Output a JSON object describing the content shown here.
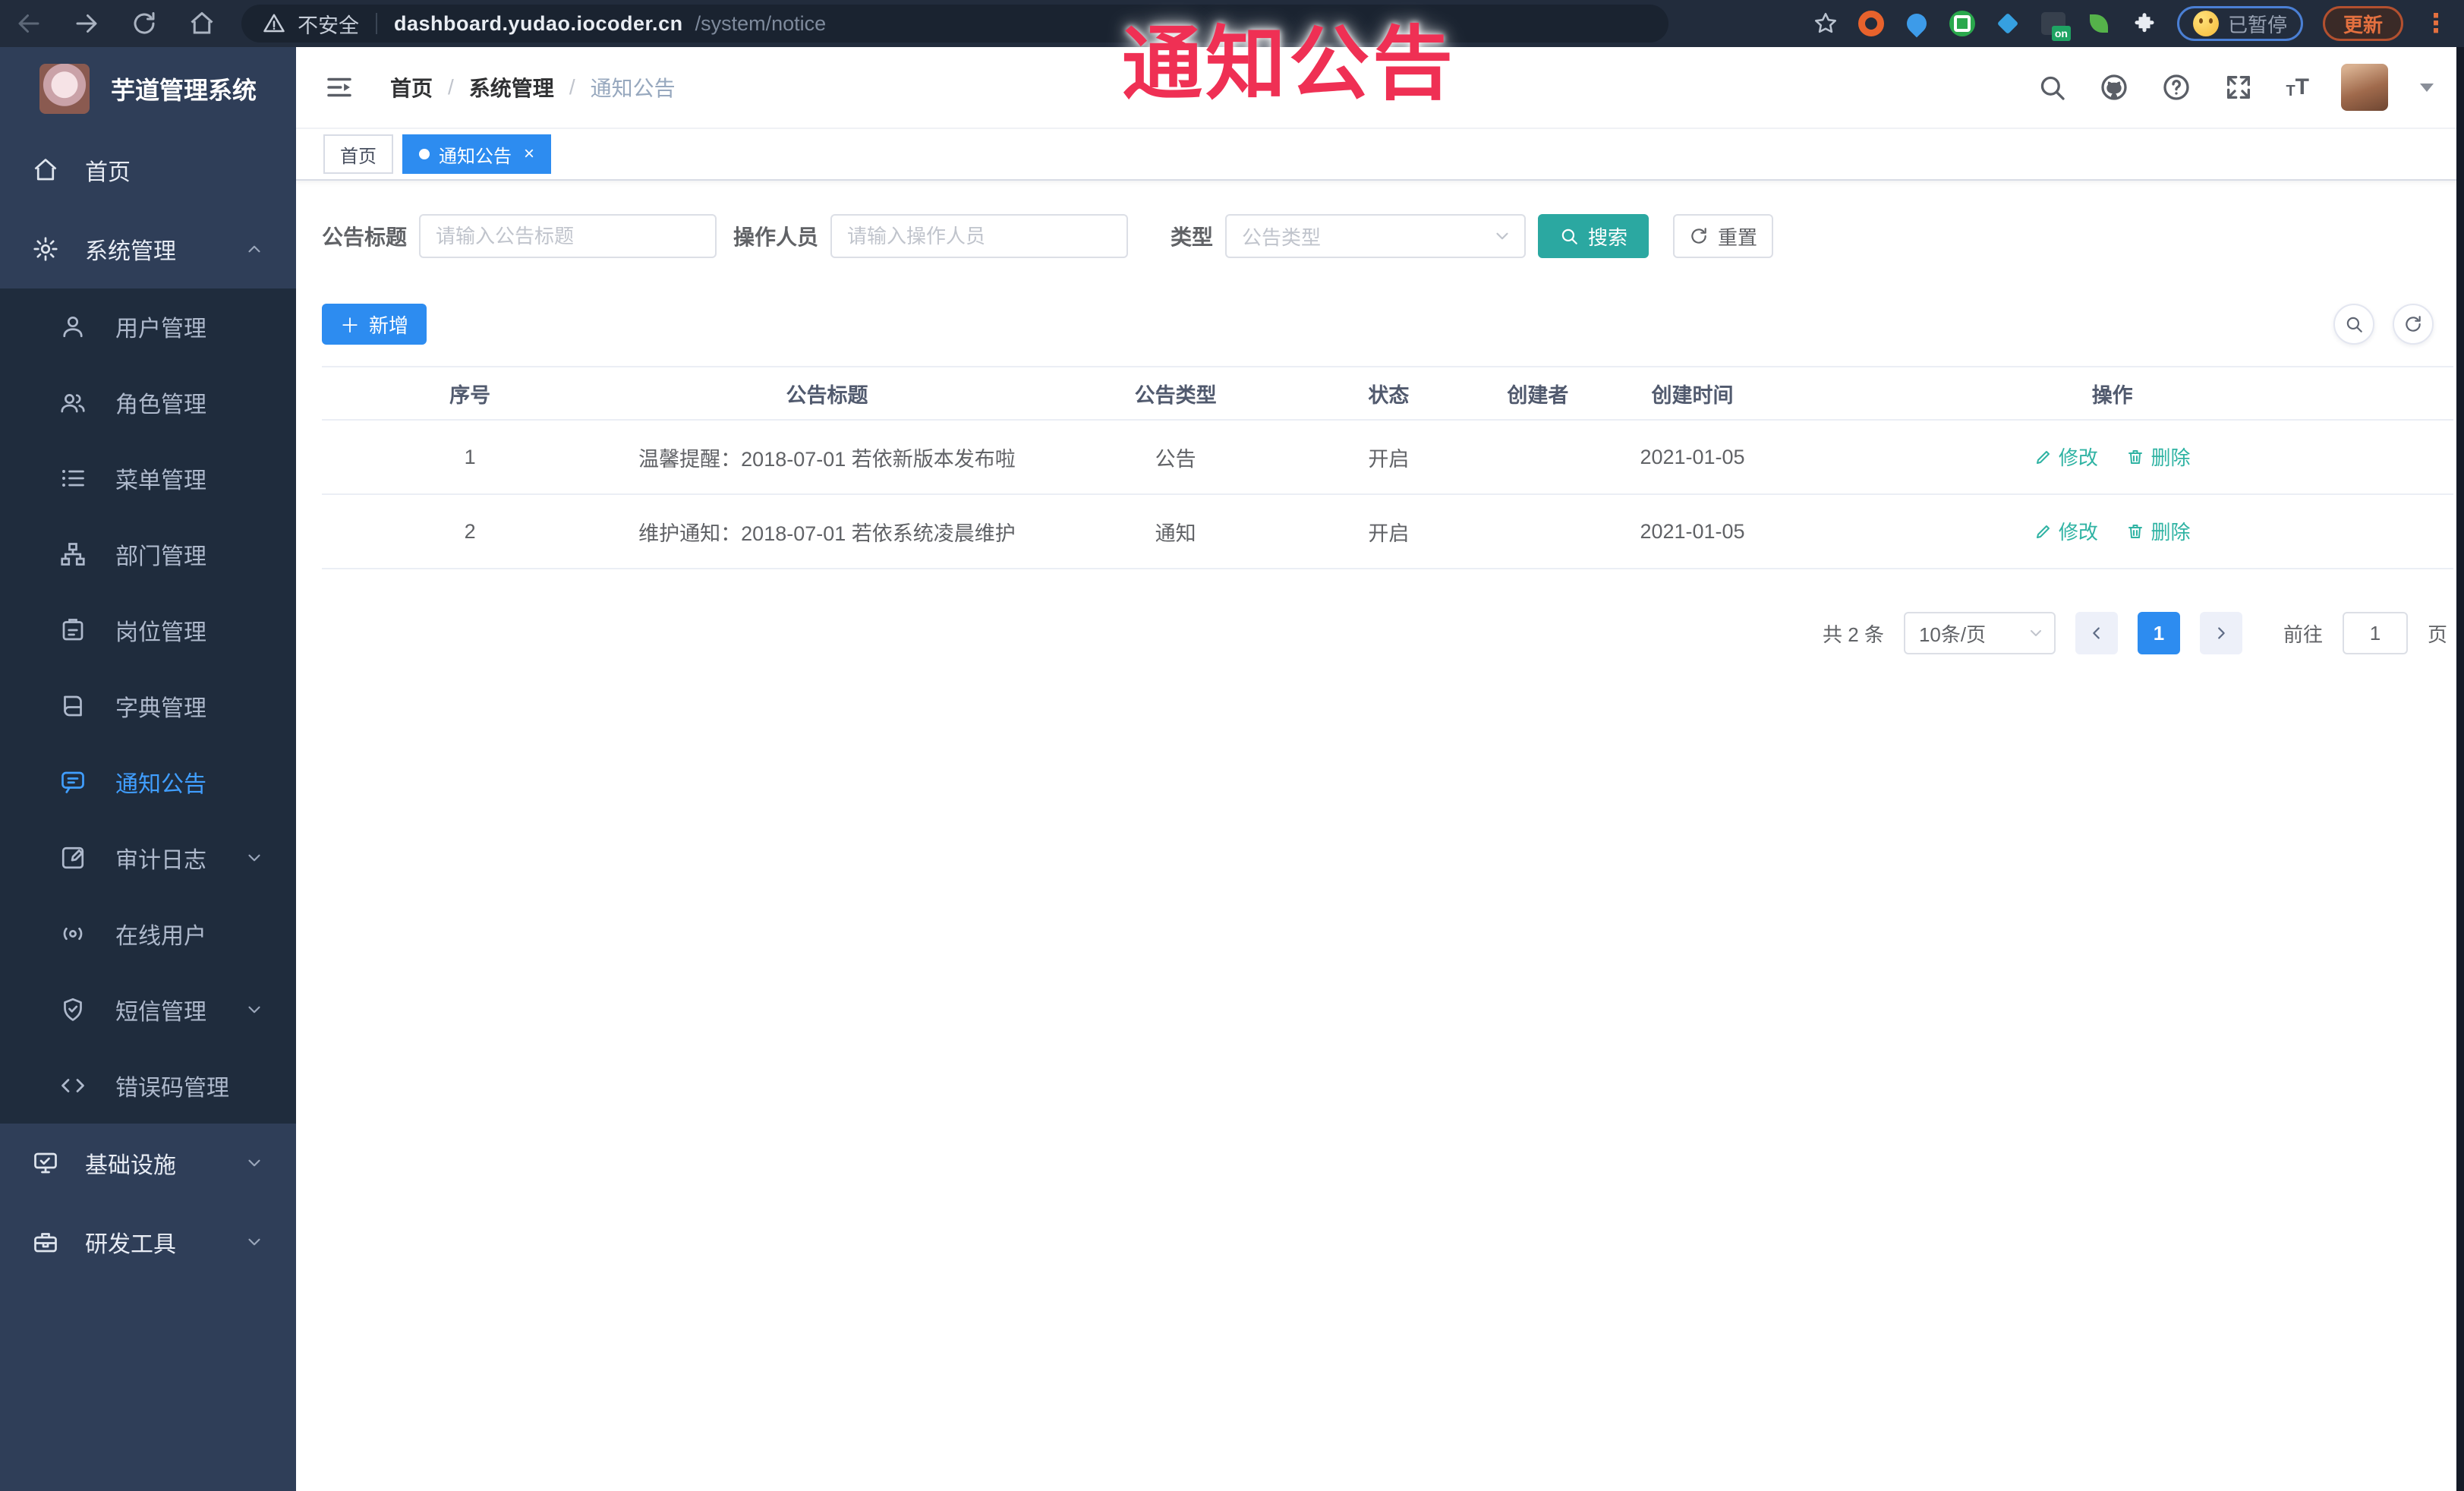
{
  "browser": {
    "security_label": "不安全",
    "url_host": "dashboard.yudao.iocoder.cn",
    "url_path": "/system/notice",
    "ext_on_badge": "on",
    "paused_label": "已暂停",
    "update_label": "更新"
  },
  "overlay_title": "通知公告",
  "sidebar": {
    "app_title": "芋道管理系统",
    "items": [
      {
        "label": "首页"
      },
      {
        "label": "系统管理"
      },
      {
        "label": "用户管理"
      },
      {
        "label": "角色管理"
      },
      {
        "label": "菜单管理"
      },
      {
        "label": "部门管理"
      },
      {
        "label": "岗位管理"
      },
      {
        "label": "字典管理"
      },
      {
        "label": "通知公告"
      },
      {
        "label": "审计日志"
      },
      {
        "label": "在线用户"
      },
      {
        "label": "短信管理"
      },
      {
        "label": "错误码管理"
      },
      {
        "label": "基础设施"
      },
      {
        "label": "研发工具"
      }
    ]
  },
  "header": {
    "breadcrumb": [
      "首页",
      "系统管理",
      "通知公告"
    ]
  },
  "tabs": [
    {
      "label": "首页",
      "active": false
    },
    {
      "label": "通知公告",
      "active": true
    }
  ],
  "filters": {
    "title_label": "公告标题",
    "title_placeholder": "请输入公告标题",
    "operator_label": "操作人员",
    "operator_placeholder": "请输入操作人员",
    "type_label": "类型",
    "type_placeholder": "公告类型",
    "search_label": "搜索",
    "reset_label": "重置"
  },
  "toolbar": {
    "add_label": "新增"
  },
  "table": {
    "columns": [
      "序号",
      "公告标题",
      "公告类型",
      "状态",
      "创建者",
      "创建时间",
      "操作"
    ],
    "rows": [
      {
        "index": "1",
        "title": "温馨提醒：2018-07-01 若依新版本发布啦",
        "type": "公告",
        "status": "开启",
        "creator": "",
        "created_at": "2021-01-05"
      },
      {
        "index": "2",
        "title": "维护通知：2018-07-01 若依系统凌晨维护",
        "type": "通知",
        "status": "开启",
        "creator": "",
        "created_at": "2021-01-05"
      }
    ],
    "actions": {
      "edit": "修改",
      "delete": "删除"
    }
  },
  "pagination": {
    "total_text": "共 2 条",
    "page_size": "10条/页",
    "current_page": "1",
    "goto_label": "前往",
    "goto_value": "1",
    "page_unit": "页"
  },
  "colors": {
    "accent_blue": "#2d8cf0",
    "active_menu_blue": "#409eff",
    "search_teal": "#2ba8a1",
    "annotation_red": "#ef3054"
  }
}
